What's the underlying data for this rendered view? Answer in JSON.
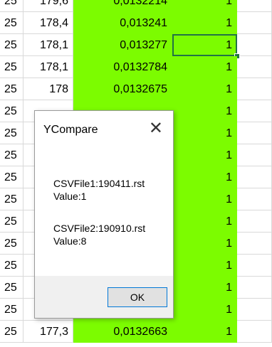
{
  "sheet": {
    "rows": [
      {
        "c0": "25",
        "c1": "179,6",
        "c2": "0,0132214",
        "c3": "1"
      },
      {
        "c0": "25",
        "c1": "178,4",
        "c2": "0,013241",
        "c3": "1"
      },
      {
        "c0": "25",
        "c1": "178,1",
        "c2": "0,013277",
        "c3": "1"
      },
      {
        "c0": "25",
        "c1": "178,1",
        "c2": "0,0132784",
        "c3": "1"
      },
      {
        "c0": "25",
        "c1": "178",
        "c2": "0,0132675",
        "c3": "1"
      },
      {
        "c0": "25",
        "c1": "",
        "c2": "",
        "c3": "1"
      },
      {
        "c0": "25",
        "c1": "",
        "c2": "",
        "c3": "1"
      },
      {
        "c0": "25",
        "c1": "",
        "c2": "",
        "c3": "1"
      },
      {
        "c0": "25",
        "c1": "",
        "c2": "",
        "c3": "1"
      },
      {
        "c0": "25",
        "c1": "",
        "c2": "",
        "c3": "1"
      },
      {
        "c0": "25",
        "c1": "",
        "c2": "",
        "c3": "1"
      },
      {
        "c0": "25",
        "c1": "",
        "c2": "",
        "c3": "1"
      },
      {
        "c0": "25",
        "c1": "",
        "c2": "",
        "c3": "1"
      },
      {
        "c0": "25",
        "c1": "",
        "c2": "",
        "c3": "1"
      },
      {
        "c0": "25",
        "c1": "",
        "c2": "",
        "c3": "1"
      },
      {
        "c0": "25",
        "c1": "177,3",
        "c2": "0,0132663",
        "c3": "1"
      }
    ],
    "selected_row_index": 2,
    "selected_column": "c3"
  },
  "dialog": {
    "title": "YCompare",
    "close_glyph": "✕",
    "line1": "CSVFile1:190411.rst",
    "line2": "Value:1",
    "line3": "CSVFile2:190910.rst",
    "line4": "Value:8",
    "ok_label": "OK"
  },
  "colors": {
    "highlight_green": "#7cfc00",
    "selection": "#217346"
  }
}
